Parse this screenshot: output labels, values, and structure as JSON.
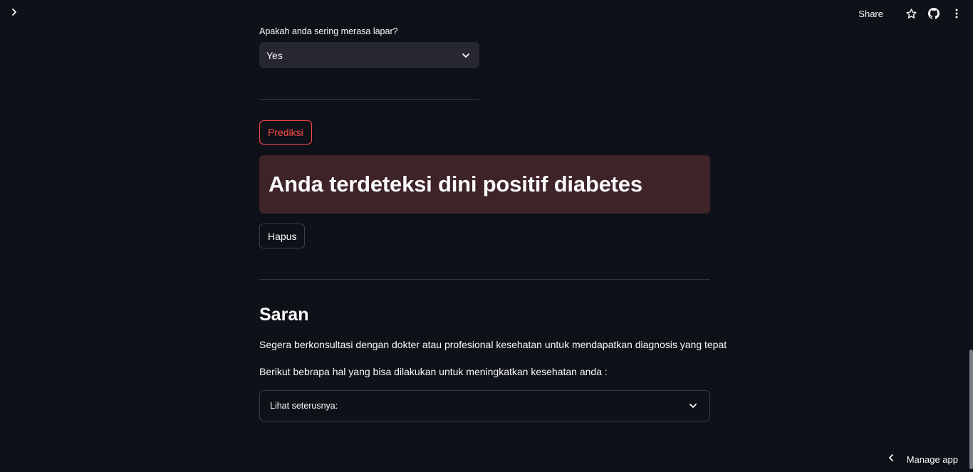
{
  "header": {
    "share_label": "Share",
    "icons": [
      "chevron-right-icon",
      "star-icon",
      "github-icon",
      "more-vert-icon"
    ]
  },
  "form": {
    "select_label": "Apakah anda sering merasa lapar?",
    "select_value": "Yes"
  },
  "actions": {
    "predict_label": "Prediksi",
    "clear_label": "Hapus"
  },
  "result": {
    "message": "Anda terdeteksi dini positif diabetes",
    "background_color": "#3e2328"
  },
  "advice": {
    "title": "Saran",
    "paragraph_1": "Segera berkonsultasi dengan dokter atau profesional kesehatan untuk mendapatkan diagnosis yang tepat",
    "paragraph_2": "Berikut bebrapa hal yang bisa dilakukan untuk meningkatkan kesehatan anda :",
    "expander_label": "Lihat seterusnya:"
  },
  "footer": {
    "manage_label": "Manage app"
  },
  "colors": {
    "background": "#0e1117",
    "accent": "#ff4b4b",
    "input_bg": "#262730"
  }
}
